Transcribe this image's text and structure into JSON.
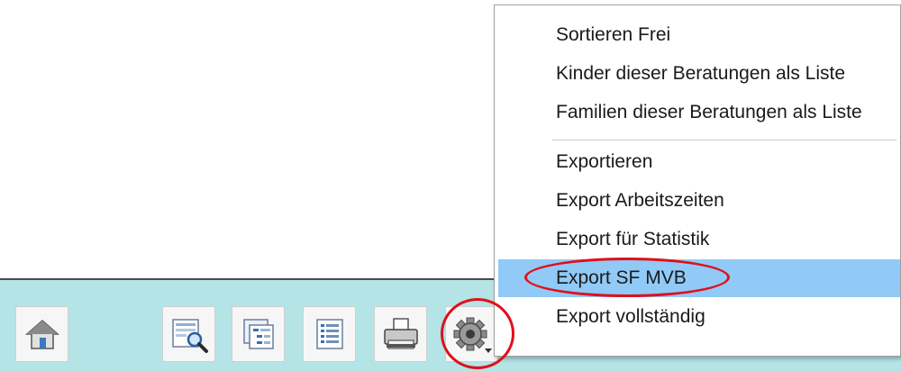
{
  "toolbar": {
    "buttons": [
      {
        "icon": "home-icon"
      },
      {
        "icon": "preview-search-icon"
      },
      {
        "icon": "tree-view-icon"
      },
      {
        "icon": "list-icon"
      },
      {
        "icon": "printer-icon"
      },
      {
        "icon": "gear-icon"
      }
    ]
  },
  "menu": {
    "items": [
      {
        "label": "Sortieren Frei"
      },
      {
        "label": "Kinder dieser Beratungen als Liste"
      },
      {
        "label": "Familien dieser Beratungen als Liste"
      },
      {
        "label": "Exportieren"
      },
      {
        "label": "Export Arbeitszeiten"
      },
      {
        "label": "Export für Statistik"
      },
      {
        "label": "Export SF MVB",
        "highlighted": true
      },
      {
        "label": "Export vollständig"
      }
    ]
  },
  "colors": {
    "toolbar_bg": "#b4e4e6",
    "menu_highlight": "#91c9f7",
    "annotation": "#e0101a"
  }
}
